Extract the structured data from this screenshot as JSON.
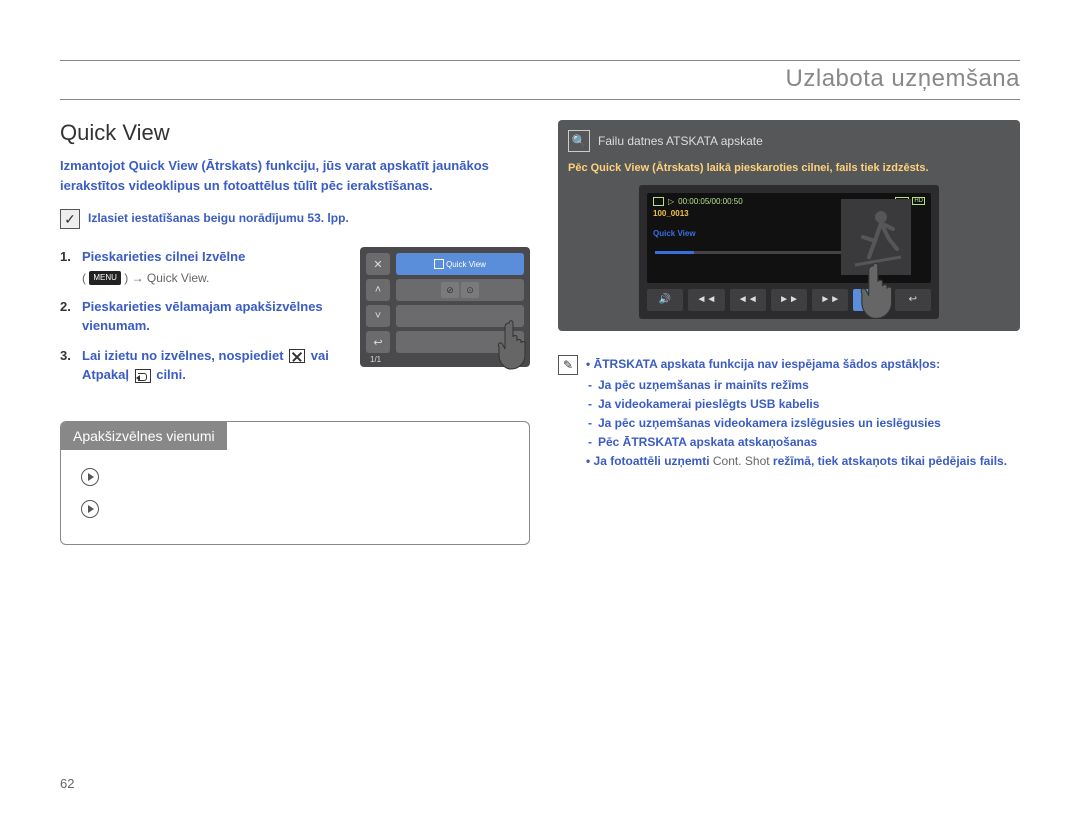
{
  "header": {
    "section": "Uzlabota uzņemšana"
  },
  "title": "Quick View",
  "intro": "Izmantojot Quick View (Ātrskats) funkciju, jūs varat apskatīt jaunākos ierakstītos videoklipus un fotoattēlus tūlīt pēc ierakstīšanas.",
  "checknote": "Izlasiet iestatīšanas beigu norādījumu 53. lpp.",
  "steps": [
    {
      "main": "Pieskarieties cilnei Izvēlne",
      "sub_pre": "(",
      "menu_label": "MENU",
      "sub_mid": ") → Quick View.",
      "sub_post": ""
    },
    {
      "main": "Pieskarieties vēlamajam apakšizvēlnes vienumam."
    },
    {
      "main_pre": "Lai izietu no izvēlnes, nospiediet",
      "main_mid": "vai Atpakaļ",
      "main_post": "cilni."
    }
  ],
  "menu_panel": {
    "highlight_label": "Quick View",
    "pager": "1/1"
  },
  "subbox": {
    "header": "Apakšizvēlnes vienumi",
    "rows": [
      {
        "label": "",
        "desc": ""
      },
      {
        "label": "",
        "desc": ""
      }
    ]
  },
  "device": {
    "title": "Failu datnes ATSKATA apskate",
    "subtitle": "Pēc Quick View (Ātrskats) laikā pieskaroties cilnei, fails tiek izdzēsts.",
    "file_label": "100_0013",
    "qv_label": "Quick View",
    "time": "00:00:05/00:00:50"
  },
  "note": {
    "line1": "• ĀTRSKATA apskata funkcija nav iespējama šādos apstākļos:",
    "bullets": [
      "Ja pēc uzņemšanas ir mainīts režīms",
      "Ja videokamerai pieslēgts USB kabelis",
      "Ja pēc uzņemšanas videokamera izslēgusies un ieslēgusies",
      "Pēc ĀTRSKATA apskata atskaņošanas"
    ],
    "line2_pre": "• Ja fotoattēli uzņemti ",
    "line2_cont": "Cont. Shot",
    "line2_post": " režīmā, tiek atskaņots tikai pēdējais fails."
  },
  "page_num": "62"
}
